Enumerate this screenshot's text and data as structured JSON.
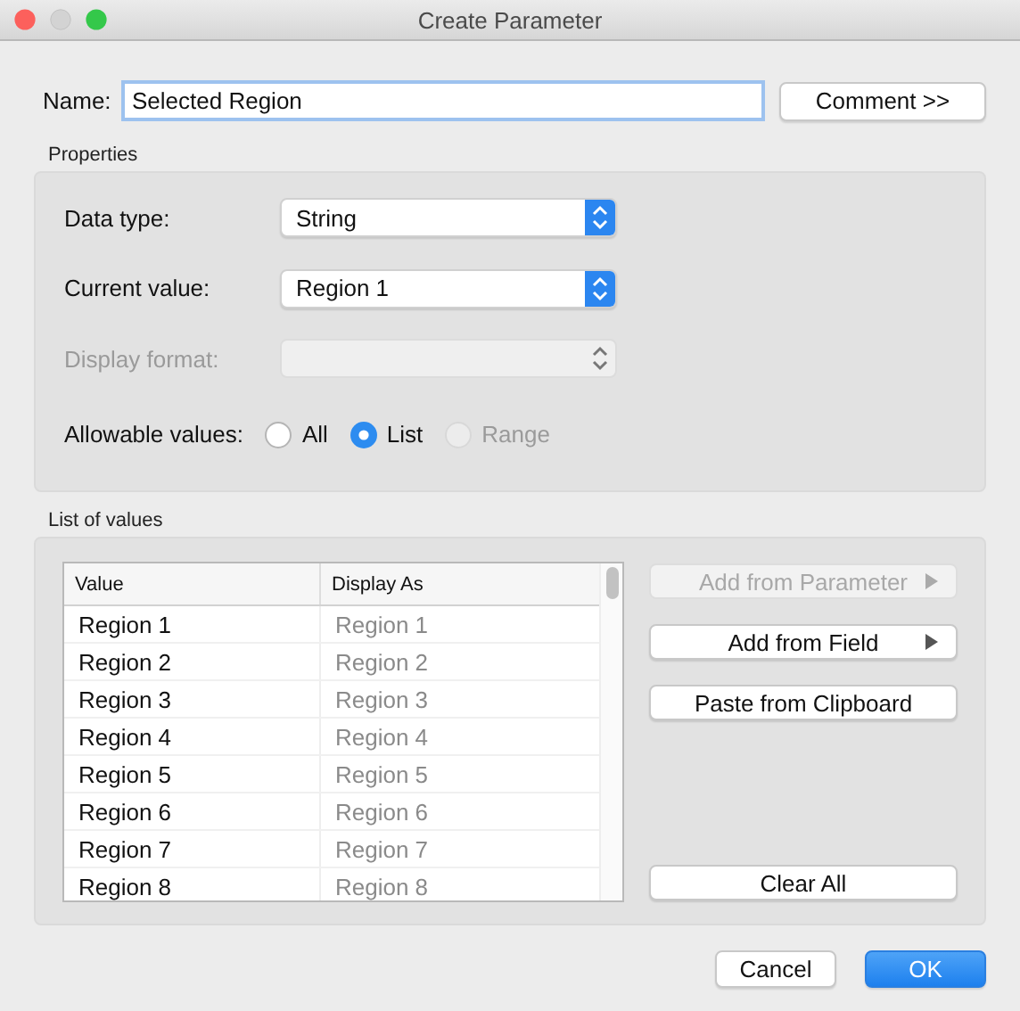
{
  "window": {
    "title": "Create Parameter"
  },
  "name_field": {
    "label": "Name:",
    "value": "Selected Region"
  },
  "comment_button": {
    "label": "Comment >>"
  },
  "properties": {
    "title": "Properties",
    "fields": [
      {
        "label": "Data type:",
        "value": "String",
        "disabled": false
      },
      {
        "label": "Current value:",
        "value": "Region 1",
        "disabled": false
      },
      {
        "label": "Display format:",
        "disabled": true
      }
    ],
    "allowable_values": {
      "label": "Allowable values:",
      "options": [
        {
          "label": "All",
          "selected": false,
          "disabled": false
        },
        {
          "label": "List",
          "selected": true,
          "disabled": false
        },
        {
          "label": "Range",
          "selected": false,
          "disabled": true
        }
      ]
    }
  },
  "list_of_values": {
    "title": "List of values",
    "columns": [
      "Value",
      "Display As"
    ],
    "rows": [
      {
        "value": "Region 1",
        "display_as": "Region 1"
      },
      {
        "value": "Region 2",
        "display_as": "Region 2"
      },
      {
        "value": "Region 3",
        "display_as": "Region 3"
      },
      {
        "value": "Region 4",
        "display_as": "Region 4"
      },
      {
        "value": "Region 5",
        "display_as": "Region 5"
      },
      {
        "value": "Region 6",
        "display_as": "Region 6"
      },
      {
        "value": "Region 7",
        "display_as": "Region 7"
      },
      {
        "value": "Region 8",
        "display_as": "Region 8"
      }
    ],
    "buttons": [
      {
        "label": "Add from Parameter",
        "disabled": true,
        "submenu": true,
        "kind": "top"
      },
      {
        "label": "Add from Field",
        "disabled": false,
        "submenu": true,
        "kind": "top"
      },
      {
        "label": "Paste from Clipboard",
        "disabled": false,
        "submenu": false,
        "kind": "top"
      },
      {
        "label": "Clear All",
        "disabled": false,
        "submenu": false,
        "kind": "bottom"
      }
    ]
  },
  "footer_buttons": [
    {
      "label": "Cancel",
      "kind": "cancel"
    },
    {
      "label": "OK",
      "kind": "default"
    }
  ]
}
